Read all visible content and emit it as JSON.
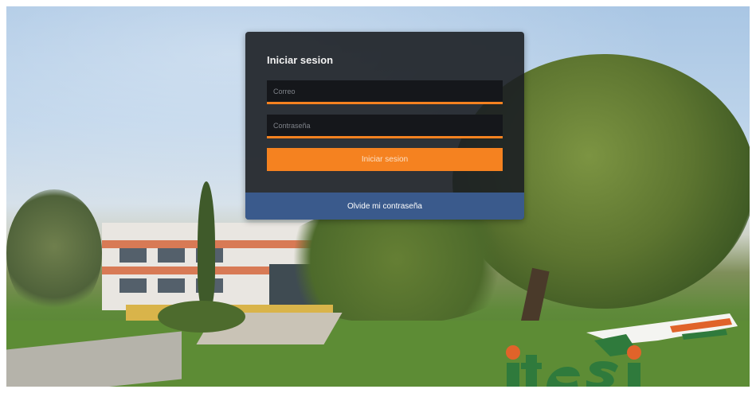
{
  "login": {
    "title": "Iniciar sesion",
    "email_placeholder": "Correo",
    "password_placeholder": "Contraseña",
    "submit_label": "Iniciar sesion",
    "forgot_label": "Olvide mi contraseña"
  },
  "colors": {
    "accent": "#f58220",
    "forgot_bar": "#3a5a8c",
    "panel": "#1c1f24"
  },
  "background": {
    "logo_text": "itesi"
  }
}
